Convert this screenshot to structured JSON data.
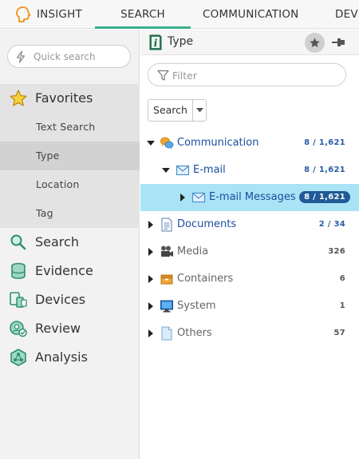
{
  "topnav": {
    "tabs": [
      {
        "label": "INSIGHT"
      },
      {
        "label": "SEARCH"
      },
      {
        "label": "COMMUNICATION"
      },
      {
        "label": "DEVI"
      }
    ],
    "active_tab": "SEARCH",
    "accent_color": "#37b18d"
  },
  "sidebar": {
    "quick_search_placeholder": "Quick search",
    "favorites": {
      "label": "Favorites",
      "items": [
        {
          "label": "Text Search"
        },
        {
          "label": "Type"
        },
        {
          "label": "Location"
        },
        {
          "label": "Tag"
        }
      ],
      "active_item": "Type"
    },
    "nav": [
      {
        "label": "Search",
        "icon": "search-icon"
      },
      {
        "label": "Evidence",
        "icon": "database-icon"
      },
      {
        "label": "Devices",
        "icon": "devices-icon"
      },
      {
        "label": "Review",
        "icon": "review-icon"
      },
      {
        "label": "Analysis",
        "icon": "analysis-icon"
      }
    ]
  },
  "panel": {
    "title": "Type",
    "filter_placeholder": "Filter",
    "search_button_label": "Search"
  },
  "tree": [
    {
      "label": "Communication",
      "count": "8 / 1,621",
      "expanded": true,
      "level": 0,
      "icon": "communication-icon"
    },
    {
      "label": "E-mail",
      "count": "8 / 1,621",
      "expanded": true,
      "level": 1,
      "icon": "email-icon"
    },
    {
      "label": "E-mail Messages",
      "count": "8 / 1,621",
      "expanded": false,
      "level": 2,
      "icon": "email-icon",
      "selected": true
    },
    {
      "label": "Documents",
      "count": "2 / 34",
      "expanded": false,
      "level": 0,
      "icon": "document-icon"
    },
    {
      "label": "Media",
      "count": "326",
      "expanded": false,
      "level": 0,
      "icon": "media-icon"
    },
    {
      "label": "Containers",
      "count": "6",
      "expanded": false,
      "level": 0,
      "icon": "container-icon"
    },
    {
      "label": "System",
      "count": "1",
      "expanded": false,
      "level": 0,
      "icon": "system-icon"
    },
    {
      "label": "Others",
      "count": "57",
      "expanded": false,
      "level": 0,
      "icon": "others-icon"
    }
  ],
  "colors": {
    "selected_row": "#a9e3f5",
    "count_pill": "#1f5a96",
    "link_blue": "#1a4fa0"
  }
}
